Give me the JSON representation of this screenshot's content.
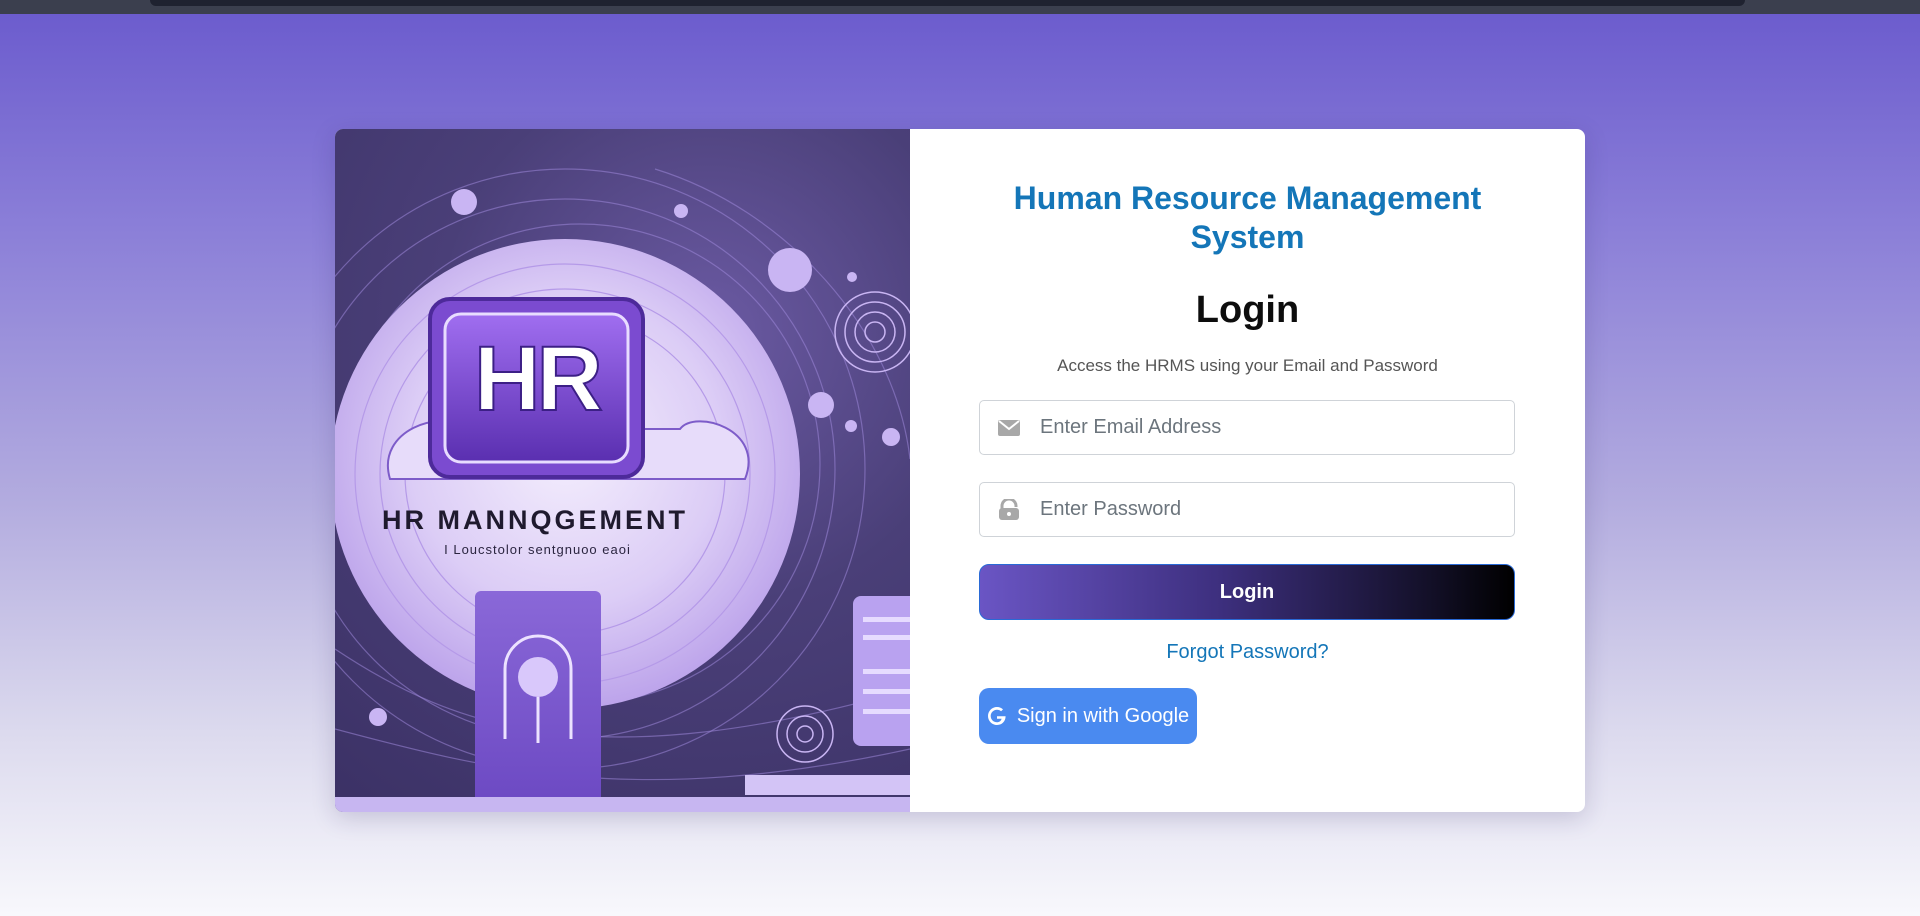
{
  "hero": {
    "logo_text": "HR",
    "banner_text": "HR MANNQGEMENT",
    "tagline_text": "I Loucstolor sentgnuoo eaoi"
  },
  "login_form": {
    "app_title": "Human Resource Management System",
    "heading": "Login",
    "subtitle": "Access the HRMS using your Email and Password",
    "email_placeholder": "Enter Email Address",
    "password_placeholder": "Enter Password",
    "login_button": "Login",
    "forgot_password": "Forgot Password?",
    "google_button": "Sign in with Google"
  },
  "icons": {
    "email": "envelope-icon",
    "password": "lock-icon",
    "google": "google-icon"
  },
  "colors": {
    "accent": "#1476b8",
    "google_blue": "#4a8af0",
    "hero_purple": "#6b4bc4"
  }
}
